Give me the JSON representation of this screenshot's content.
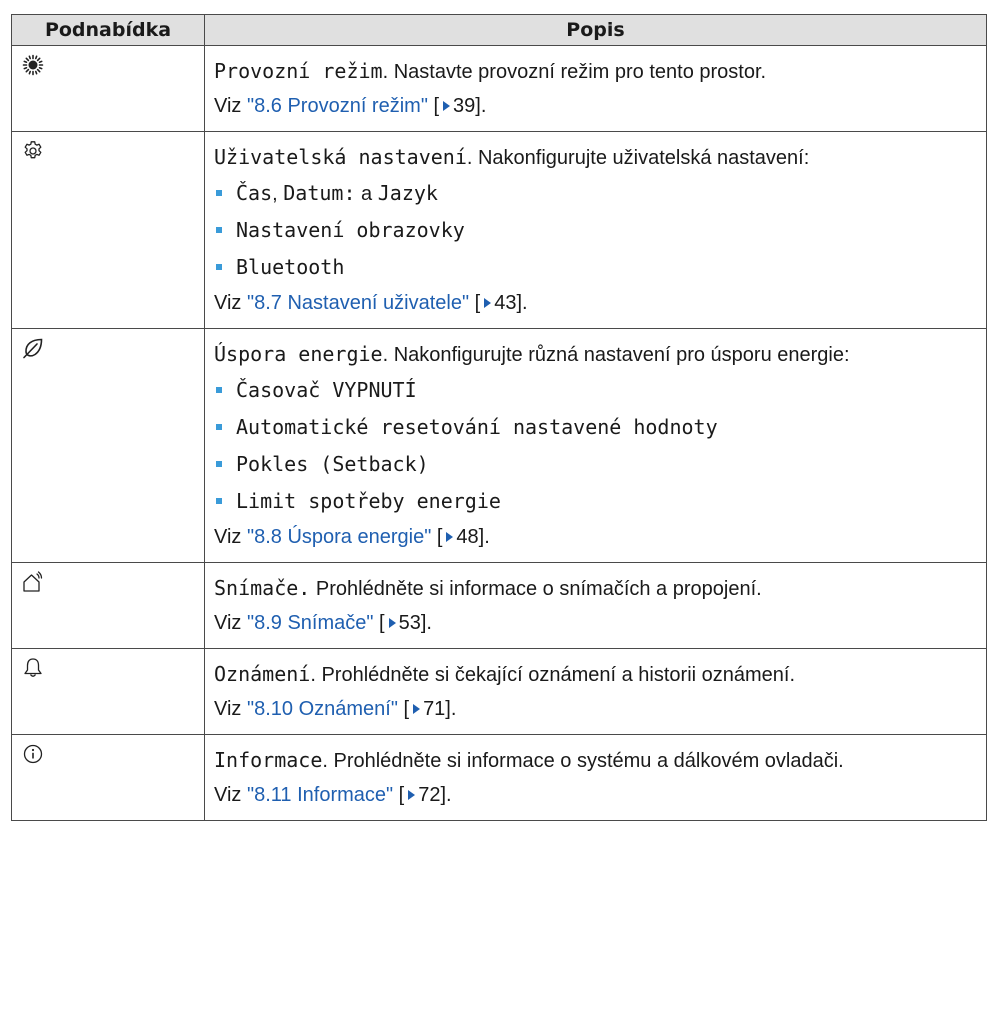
{
  "header": {
    "col1": "Podnabídka",
    "col2": "Popis"
  },
  "rows": [
    {
      "icon": "sun-icon",
      "title": "Provozní režim",
      "text": ". Nastavte provozní režim pro tento prostor.",
      "bullets": [],
      "see": "Viz ",
      "link": "\"8.6 Provozní režim\"",
      "page": "39]."
    },
    {
      "icon": "gear-icon",
      "title": "Uživatelská nastavení",
      "text": ". Nakonfigurujte uživatelská nastavení:",
      "bullets": [
        {
          "a": "Čas",
          "sep1": ",",
          "b": "Datum:",
          "sep2": " a ",
          "c": "Jazyk"
        },
        {
          "a": "Nastavení obrazovky"
        },
        {
          "a": "Bluetooth"
        }
      ],
      "see": "Viz ",
      "link": "\"8.7 Nastavení uživatele\"",
      "page": "43]."
    },
    {
      "icon": "leaf-icon",
      "title": "Úspora energie",
      "text": ". Nakonfigurujte různá nastavení pro úsporu energie:",
      "bullets": [
        {
          "a": "Časovač VYPNUTÍ"
        },
        {
          "a": "Automatické resetování nastavené hodnoty"
        },
        {
          "a": "Pokles (Setback)"
        },
        {
          "a": "Limit spotřeby energie"
        }
      ],
      "see": "Viz ",
      "link": "\"8.8 Úspora energie\"",
      "page": "48]."
    },
    {
      "icon": "home-sensor-icon",
      "title": "Snímače.",
      "text": " Prohlédněte si informace o snímačích a propojení.",
      "bullets": [],
      "see": "Viz ",
      "link": "\"8.9 Snímače\"",
      "page": "53]."
    },
    {
      "icon": "bell-icon",
      "title": "Oznámení",
      "text": ". Prohlédněte si čekající oznámení a historii oznámení.",
      "bullets": [],
      "see": "Viz ",
      "link": "\"8.10 Oznámení\"",
      "page": "71]."
    },
    {
      "icon": "info-icon",
      "title": "Informace",
      "text": ". Prohlédněte si informace o systému a dálkovém ovladači.",
      "bullets": [],
      "see": "Viz ",
      "link": "\"8.11 Informace\"",
      "page": "72]."
    }
  ],
  "bracket_open": "["
}
